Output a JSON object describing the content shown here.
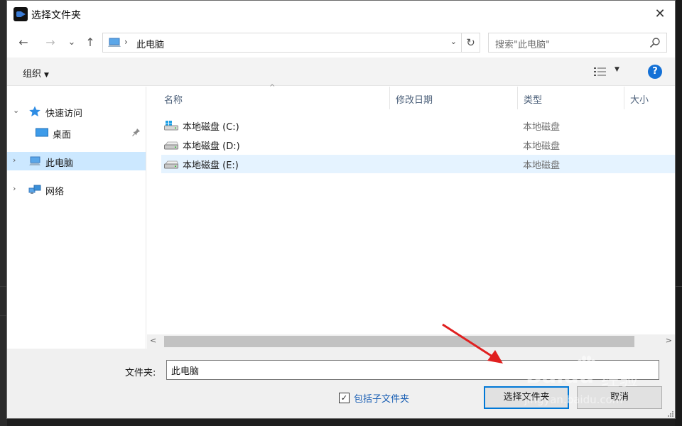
{
  "dialog": {
    "title": "选择文件夹",
    "close_label": "✕"
  },
  "nav": {
    "back": "←",
    "forward": "→",
    "recent": "⌄",
    "up": "↑",
    "address_sep": "›",
    "address": "此电脑",
    "address_dropdown": "⌄",
    "refresh": "↻",
    "search_placeholder": "搜索\"此电脑\""
  },
  "toolbar": {
    "organize": "组织",
    "organize_caret": "▼",
    "view_caret": "▼",
    "help": "?"
  },
  "sidebar": {
    "items": [
      {
        "label": "快速访问",
        "chevron": "⌄",
        "icon": "star-icon"
      },
      {
        "label": "桌面",
        "icon": "desktop-icon",
        "pinned": true
      },
      {
        "label": "此电脑",
        "chevron": "›",
        "icon": "computer-icon",
        "selected": true
      },
      {
        "label": "网络",
        "chevron": "›",
        "icon": "network-icon"
      }
    ]
  },
  "columns": {
    "name": "名称",
    "modified": "修改日期",
    "type": "类型",
    "size": "大小",
    "sort_arrow": "^"
  },
  "files": [
    {
      "name": "本地磁盘 (C:)",
      "type": "本地磁盘",
      "icon": "windows-drive-icon"
    },
    {
      "name": "本地磁盘 (D:)",
      "type": "本地磁盘",
      "icon": "drive-icon"
    },
    {
      "name": "本地磁盘 (E:)",
      "type": "本地磁盘",
      "icon": "drive-icon",
      "selected": true
    }
  ],
  "scrollbar": {
    "left": "<",
    "right": ">"
  },
  "bottom": {
    "folder_label": "文件夹:",
    "folder_value": "此电脑",
    "checkbox_mark": "✓",
    "checkbox_label": "包括子文件夹",
    "select_button": "选择文件夹",
    "cancel_button": "取消"
  },
  "watermark": {
    "brand": "Baidu",
    "brand_cn": "经验",
    "url": "jingyan.baidu.com"
  },
  "colors": {
    "accent": "#0078d7",
    "selection": "#cce8ff",
    "annotation_arrow": "#e02020"
  }
}
